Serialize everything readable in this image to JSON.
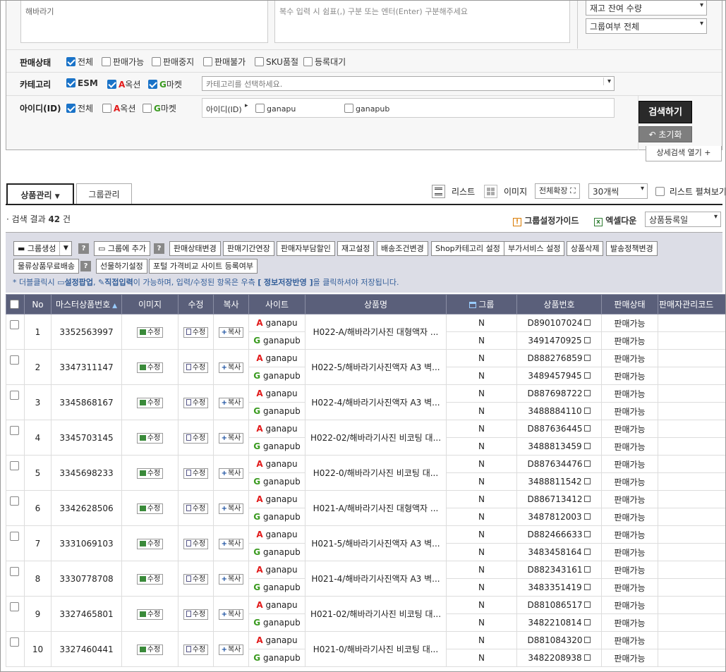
{
  "search": {
    "textarea_left": "해바라기",
    "textarea_right": "복수 입력 시 쉼표(,) 구분 또는 엔터(Enter) 구분해주세요",
    "stock_select": "재고 잔여 수량",
    "group_select": "그룹여부 전체",
    "sale_status_label": "판매상태",
    "sale_status_options": [
      "전체",
      "판매가능",
      "판매중지",
      "판매불가",
      "SKU품절",
      "등록대기"
    ],
    "category_label": "카테고리",
    "category_options": [
      "ESM",
      "옥션",
      "마켓"
    ],
    "category_placeholder": "카테고리를 선택하세요.",
    "id_label": "아이디(ID)",
    "id_options": [
      "전체",
      "옥션",
      "마켓"
    ],
    "id_box_label": "아이디(ID)",
    "id_values": [
      "ganapu",
      "ganapub"
    ],
    "search_button": "검색하기",
    "reset_button": "초기화",
    "detail_toggle": "상세검색 열기"
  },
  "tabs": [
    "상품관리",
    "그룹관리"
  ],
  "toolbar": {
    "list": "리스트",
    "image": "이미지",
    "fullscreen": "전체확장",
    "per_page": "30개씩",
    "list_expand": "리스트 펼쳐보기"
  },
  "result": {
    "prefix": "검색 결과",
    "count": "42",
    "suffix": "건"
  },
  "right_tools": {
    "guide": "그룹설정가이드",
    "excel": "엑셀다운",
    "sort_select": "상품등록일"
  },
  "actions": {
    "group_create": "그룹생성",
    "group_add": "그룹에 추가",
    "row1": [
      "판매상태변경",
      "판매기간연장",
      "판매자부담할인",
      "재고설정",
      "배송조건변경",
      "Shop카테고리 설정",
      "부가서비스 설정",
      "상품삭제",
      "발송정책변경"
    ],
    "row2": [
      "물류상품무료배송",
      "선물하기설정",
      "포털 가격비교 사이트 등록여부"
    ],
    "notice_pre": "* 더블클릭시",
    "notice_popup": "설정팝업",
    "notice_direct": "직접입력",
    "notice_mid": "이 가능하며, 입력/수정된 항목은 우측",
    "notice_bracket": "[ 정보저장반영 ]",
    "notice_end": "을 클릭하셔야 저장됩니다."
  },
  "table": {
    "headers": [
      "No",
      "마스터상품번호",
      "이미지",
      "수정",
      "복사",
      "사이트",
      "상품명",
      "그룹",
      "상품번호",
      "판매상태",
      "판매자관리코드"
    ],
    "edit_label": "수정",
    "copy_label": "복사",
    "rows": [
      {
        "no": "1",
        "master": "3352563997",
        "name": "H022-A/해바라기사진 대형액자 ...",
        "sites": [
          {
            "mark": "A",
            "id": "ganapu",
            "group": "N",
            "product_no": "D890107024",
            "status": "판매가능"
          },
          {
            "mark": "G",
            "id": "ganapub",
            "group": "N",
            "product_no": "3491470925",
            "status": "판매가능"
          }
        ]
      },
      {
        "no": "2",
        "master": "3347311147",
        "name": "H022-5/해바라기사진액자 A3 벽...",
        "sites": [
          {
            "mark": "A",
            "id": "ganapu",
            "group": "N",
            "product_no": "D888276859",
            "status": "판매가능"
          },
          {
            "mark": "G",
            "id": "ganapub",
            "group": "N",
            "product_no": "3489457945",
            "status": "판매가능"
          }
        ]
      },
      {
        "no": "3",
        "master": "3345868167",
        "name": "H022-4/해바라기사진액자 A3 벽...",
        "sites": [
          {
            "mark": "A",
            "id": "ganapu",
            "group": "N",
            "product_no": "D887698722",
            "status": "판매가능"
          },
          {
            "mark": "G",
            "id": "ganapub",
            "group": "N",
            "product_no": "3488884110",
            "status": "판매가능"
          }
        ]
      },
      {
        "no": "4",
        "master": "3345703145",
        "name": "H022-02/해바라기사진 비코팅 대...",
        "sites": [
          {
            "mark": "A",
            "id": "ganapu",
            "group": "N",
            "product_no": "D887636445",
            "status": "판매가능"
          },
          {
            "mark": "G",
            "id": "ganapub",
            "group": "N",
            "product_no": "3488813459",
            "status": "판매가능"
          }
        ]
      },
      {
        "no": "5",
        "master": "3345698233",
        "name": "H022-0/해바라기사진 비코팅 대...",
        "sites": [
          {
            "mark": "A",
            "id": "ganapu",
            "group": "N",
            "product_no": "D887634476",
            "status": "판매가능"
          },
          {
            "mark": "G",
            "id": "ganapub",
            "group": "N",
            "product_no": "3488811542",
            "status": "판매가능"
          }
        ]
      },
      {
        "no": "6",
        "master": "3342628506",
        "name": "H021-A/해바라기사진 대형액자 ...",
        "sites": [
          {
            "mark": "A",
            "id": "ganapu",
            "group": "N",
            "product_no": "D886713412",
            "status": "판매가능"
          },
          {
            "mark": "G",
            "id": "ganapub",
            "group": "N",
            "product_no": "3487812003",
            "status": "판매가능"
          }
        ]
      },
      {
        "no": "7",
        "master": "3331069103",
        "name": "H021-5/해바라기사진액자 A3 벽...",
        "sites": [
          {
            "mark": "A",
            "id": "ganapu",
            "group": "N",
            "product_no": "D882466633",
            "status": "판매가능"
          },
          {
            "mark": "G",
            "id": "ganapub",
            "group": "N",
            "product_no": "3483458164",
            "status": "판매가능"
          }
        ]
      },
      {
        "no": "8",
        "master": "3330778708",
        "name": "H021-4/해바라기사진액자 A3 벽...",
        "sites": [
          {
            "mark": "A",
            "id": "ganapu",
            "group": "N",
            "product_no": "D882343161",
            "status": "판매가능"
          },
          {
            "mark": "G",
            "id": "ganapub",
            "group": "N",
            "product_no": "3483351419",
            "status": "판매가능"
          }
        ]
      },
      {
        "no": "9",
        "master": "3327465801",
        "name": "H021-02/해바라기사진 비코팅 대...",
        "sites": [
          {
            "mark": "A",
            "id": "ganapu",
            "group": "N",
            "product_no": "D881086517",
            "status": "판매가능"
          },
          {
            "mark": "G",
            "id": "ganapub",
            "group": "N",
            "product_no": "3482210814",
            "status": "판매가능"
          }
        ]
      },
      {
        "no": "10",
        "master": "3327460441",
        "name": "H021-0/해바라기사진 비코팅 대...",
        "sites": [
          {
            "mark": "A",
            "id": "ganapu",
            "group": "N",
            "product_no": "D881084320",
            "status": "판매가능"
          },
          {
            "mark": "G",
            "id": "ganapub",
            "group": "N",
            "product_no": "3482208938",
            "status": "판매가능"
          }
        ]
      }
    ]
  },
  "colors": {
    "header_bg": "#5a5f7a",
    "action_bg": "#dcdde6",
    "auction_red": "#e21b1b",
    "gmarket_green": "#3a9a1f",
    "checkbox_blue": "#1a73c8"
  }
}
